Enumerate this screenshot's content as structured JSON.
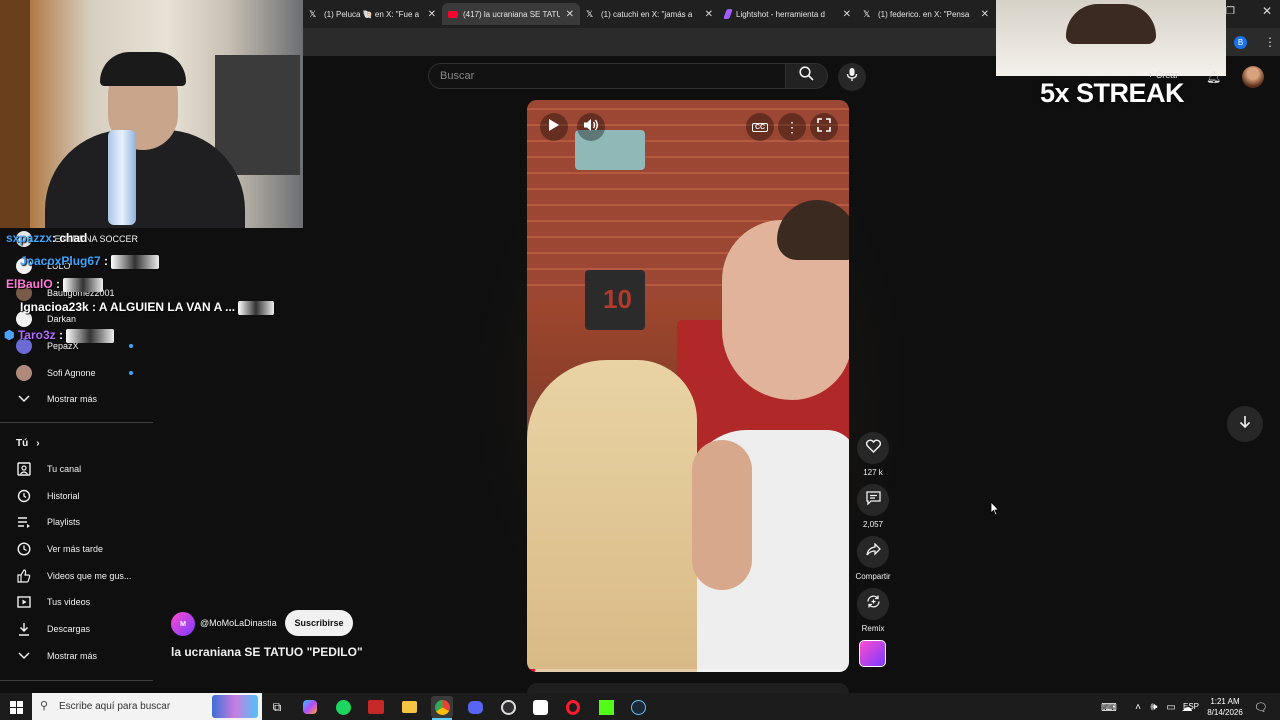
{
  "browser": {
    "tabs": [
      {
        "title": "(1) Peluca 🐚 en X: \"Fue a",
        "icon": "x-logo-icon",
        "color": "#ffffff"
      },
      {
        "title": "(417) la ucraniana SE TATU",
        "icon": "youtube-icon",
        "color": "#ff0033"
      },
      {
        "title": "(1) catuchi en X: \"jamás a",
        "icon": "x-logo-icon",
        "color": "#ffffff"
      },
      {
        "title": "Lightshot - herramienta d",
        "icon": "lightshot-icon",
        "color": "#a05cff"
      },
      {
        "title": "(1) federico. en X: \"Pensa",
        "icon": "x-logo-icon",
        "color": "#ffffff"
      }
    ],
    "profile_badge": "B"
  },
  "overlay": {
    "streak_text": "5x STREAK",
    "create_label": "+ Crear"
  },
  "chat": [
    {
      "user": "sxpazzx",
      "message": ": chad",
      "color": "#3ea6ff"
    },
    {
      "user": "JoacoxPlug67",
      "message": " :",
      "color": "#3ea6ff"
    },
    {
      "user": "ElBaulO",
      "message": " :",
      "color": "#ff7ad9"
    },
    {
      "user": "Ignacioa23k",
      "message": " : A ALGUIEN LA VAN A ...",
      "color": "#ffffff"
    },
    {
      "user": "Taro3z",
      "message": " :",
      "color": "#b46bff"
    }
  ],
  "sidebar": {
    "subscriptions": [
      {
        "label": "...ENTRENA SOCCER"
      },
      {
        "label": "LULO"
      },
      {
        "label": "Bautigomez2001"
      },
      {
        "label": "Darkan"
      },
      {
        "label": "PepazX",
        "live": true
      },
      {
        "label": "Sofi Agnone",
        "live": true
      },
      {
        "label": "Mostrar más"
      }
    ],
    "you_header": "Tú",
    "you_items": [
      {
        "label": "Tu canal",
        "icon": "channel-icon"
      },
      {
        "label": "Historial",
        "icon": "history-icon"
      },
      {
        "label": "Playlists",
        "icon": "playlists-icon"
      },
      {
        "label": "Ver más tarde",
        "icon": "clock-icon"
      },
      {
        "label": "Videos que me gus...",
        "icon": "thumbs-up-icon"
      },
      {
        "label": "Tus videos",
        "icon": "video-icon"
      },
      {
        "label": "Descargas",
        "icon": "download-icon"
      },
      {
        "label": "Mostrar más",
        "icon": "chevron-down-icon"
      }
    ]
  },
  "search": {
    "placeholder": "Buscar"
  },
  "short": {
    "channel": "@MoMoLaDinastia",
    "subscribe_label": "Suscribirse",
    "title": "la ucraniana SE TATUO \"PEDILO\"",
    "likes": "127 k",
    "comments": "2,057",
    "share_label": "Compartir",
    "remix_label": "Remix",
    "video_sign": "10"
  },
  "taskbar": {
    "search_placeholder": "Escribe aquí para buscar",
    "language": "ESP",
    "time": "1:21 AM",
    "date": "8/14/2026"
  }
}
